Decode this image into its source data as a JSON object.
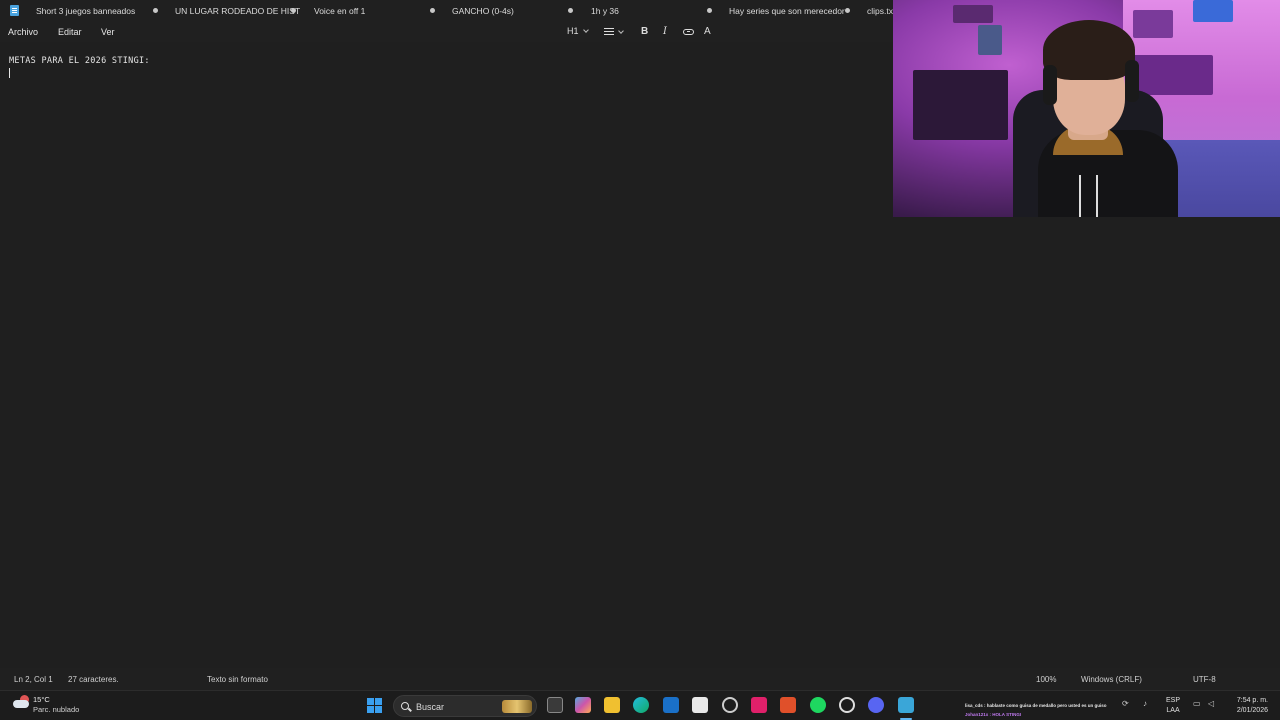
{
  "tabs": [
    {
      "label": "Short 3 juegos banneados"
    },
    {
      "label": "UN LUGAR RODEADO DE HIST"
    },
    {
      "label": "Voice en off 1"
    },
    {
      "label": "GANCHO (0-4s)"
    },
    {
      "label": "1h y 36"
    },
    {
      "label": "Hay series que son merecedor"
    },
    {
      "label": "clips.txt"
    }
  ],
  "menu": {
    "file": "Archivo",
    "edit": "Editar",
    "view": "Ver"
  },
  "format_toolbar": {
    "heading": "H1",
    "bold": "B",
    "italic": "I",
    "clear_format": "A"
  },
  "document": {
    "line1": "METAS PARA EL 2026 STINGI:"
  },
  "status": {
    "position": "Ln 2, Col 1",
    "chars": "27 caracteres.",
    "format": "Texto sin formato",
    "zoom": "100%",
    "line_ending": "Windows (CRLF)",
    "encoding": "UTF-8"
  },
  "taskbar": {
    "temperature": "15°C",
    "condition": "Parc. nublado",
    "search_placeholder": "Buscar",
    "chat_line1": "lisa_cds : hablaste como guisa de medallo pero usted es un guiso",
    "chat_line2": "Johan121x : HOLA STINGI",
    "lang_1": "ESP",
    "lang_2": "LAA",
    "time": "7:54 p. m.",
    "date": "2/01/2026"
  },
  "colors": {
    "background": "#202020",
    "accent": "#60b4f0"
  }
}
